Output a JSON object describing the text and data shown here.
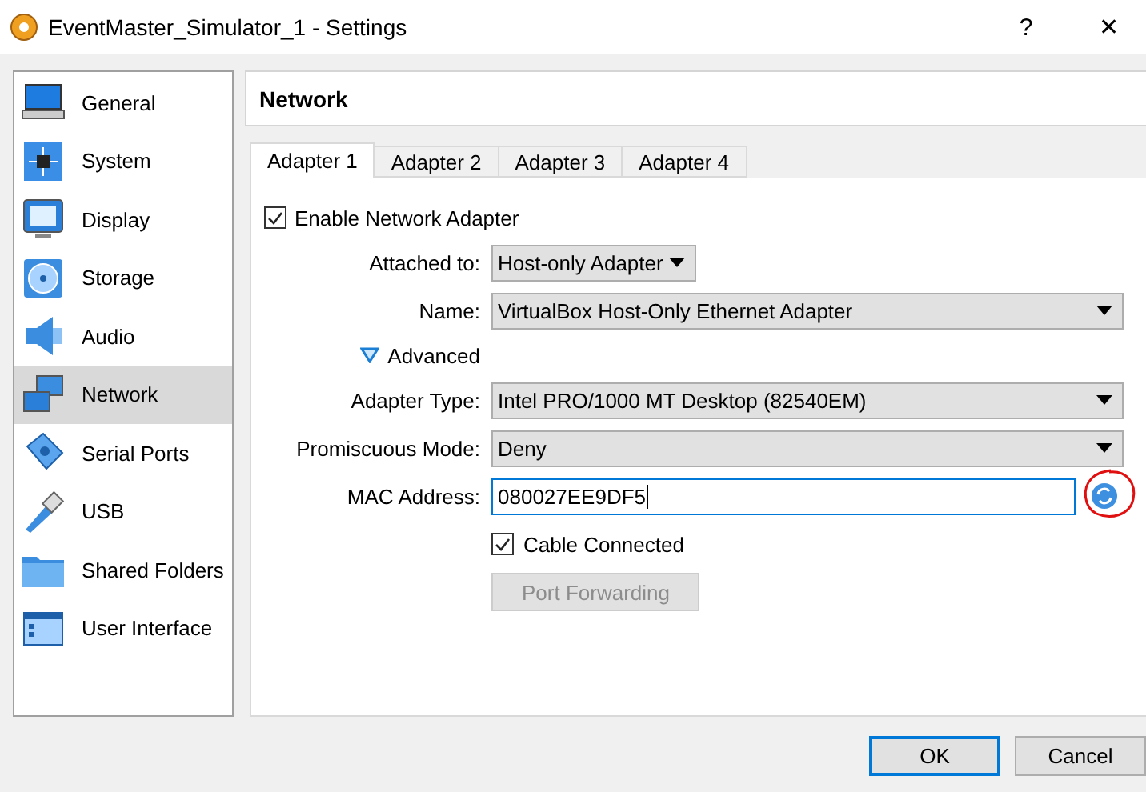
{
  "window": {
    "title": "EventMaster_Simulator_1 - Settings",
    "help": "?",
    "close": "✕"
  },
  "sidebar": {
    "items": [
      {
        "label": "General",
        "kind": "general",
        "selected": false
      },
      {
        "label": "System",
        "kind": "system",
        "selected": false
      },
      {
        "label": "Display",
        "kind": "display",
        "selected": false
      },
      {
        "label": "Storage",
        "kind": "storage",
        "selected": false
      },
      {
        "label": "Audio",
        "kind": "audio",
        "selected": false
      },
      {
        "label": "Network",
        "kind": "network",
        "selected": true
      },
      {
        "label": "Serial Ports",
        "kind": "serial",
        "selected": false
      },
      {
        "label": "USB",
        "kind": "usb",
        "selected": false
      },
      {
        "label": "Shared Folders",
        "kind": "folders",
        "selected": false
      },
      {
        "label": "User Interface",
        "kind": "interface",
        "selected": false
      }
    ]
  },
  "page": {
    "title": "Network"
  },
  "tabs": [
    {
      "label": "Adapter 1",
      "selected": true
    },
    {
      "label": "Adapter 2",
      "selected": false
    },
    {
      "label": "Adapter 3",
      "selected": false
    },
    {
      "label": "Adapter 4",
      "selected": false
    }
  ],
  "enable": {
    "label": "Enable Network Adapter",
    "checked": true
  },
  "rows": [
    {
      "kind": "compact-select",
      "label": "Attached to:",
      "value": "Host-only Adapter"
    },
    {
      "kind": "select",
      "label": "Name:",
      "value": "VirtualBox Host-Only Ethernet Adapter"
    },
    {
      "kind": "expander",
      "label": "Advanced",
      "expanded": true
    },
    {
      "kind": "select",
      "label": "Adapter Type:",
      "value": "Intel PRO/1000 MT Desktop (82540EM)"
    },
    {
      "kind": "select",
      "label": "Promiscuous Mode:",
      "value": "Deny"
    },
    {
      "kind": "text",
      "label": "MAC Address:",
      "value": "080027EE9DF5"
    },
    {
      "kind": "checkbox",
      "label": "Cable Connected",
      "checked": true
    },
    {
      "kind": "button",
      "label": "Port Forwarding",
      "disabled": true
    }
  ],
  "buttons": [
    {
      "label": "OK",
      "default": true
    },
    {
      "label": "Cancel",
      "default": false
    }
  ]
}
